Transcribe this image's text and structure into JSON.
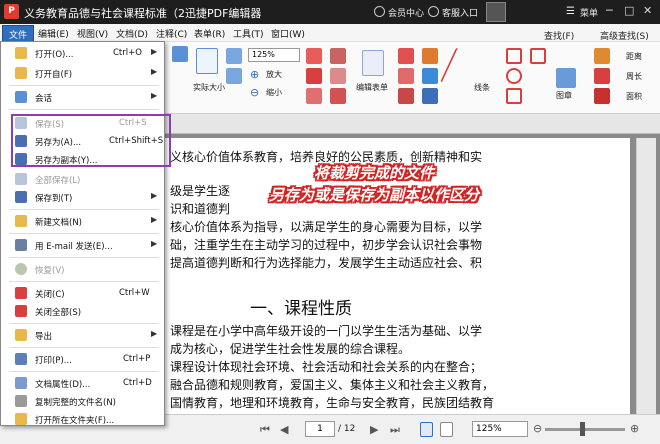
{
  "window": {
    "app_logo": "P",
    "title": "义务教育品德与社会课程标准（2迅捷PDF编辑器",
    "member_center": "会员中心",
    "client_login": "客服入口",
    "menu": "菜单",
    "win_controls": [
      "─",
      "□",
      "✕"
    ]
  },
  "menubar": [
    "文件",
    "编辑(E)",
    "视图(V)",
    "文档(D)",
    "注释(C)",
    "表单(R)",
    "工具(T)",
    "窗口(W)"
  ],
  "ribbon": {
    "zoom": "125%",
    "zoom_in": "放大",
    "zoom_out": "缩小",
    "actual_size": "实际大小",
    "edit_content": "编辑表单",
    "lines": "线条",
    "shapes": "图章",
    "find": "查找(F)",
    "advanced_find": "高级查找(S)",
    "distance": "距离",
    "perimeter": "周长",
    "area": "面积"
  },
  "file_menu": [
    {
      "label": "打开(O)...",
      "shortcut": "Ctrl+O",
      "arrow": true,
      "enabled": true,
      "icon": "open-folder-icon"
    },
    {
      "label": "打开自(F)",
      "shortcut": "",
      "arrow": true,
      "enabled": true,
      "icon": "open-from-icon"
    },
    {
      "label": "会话",
      "shortcut": "",
      "arrow": true,
      "enabled": true,
      "icon": "session-icon"
    },
    {
      "label": "保存(S)",
      "shortcut": "Ctrl+S",
      "arrow": false,
      "enabled": false,
      "icon": "save-icon"
    },
    {
      "label": "另存为(A)...",
      "shortcut": "Ctrl+Shift+S",
      "arrow": false,
      "enabled": true,
      "icon": "save-as-icon"
    },
    {
      "label": "另存为副本(Y)...",
      "shortcut": "",
      "arrow": false,
      "enabled": true,
      "icon": "save-copy-icon"
    },
    {
      "label": "全部保存(L)",
      "shortcut": "",
      "arrow": false,
      "enabled": false,
      "icon": "save-all-icon"
    },
    {
      "label": "保存到(T)",
      "shortcut": "",
      "arrow": true,
      "enabled": true,
      "icon": "save-to-icon"
    },
    {
      "label": "新建文档(N)",
      "shortcut": "",
      "arrow": true,
      "enabled": true,
      "icon": "new-document-icon"
    },
    {
      "label": "用 E-mail 发送(E)...",
      "shortcut": "",
      "arrow": true,
      "enabled": true,
      "icon": "email-icon"
    },
    {
      "label": "恢复(V)",
      "shortcut": "",
      "arrow": false,
      "enabled": false,
      "icon": "revert-icon"
    },
    {
      "label": "关闭(C)",
      "shortcut": "Ctrl+W",
      "arrow": false,
      "enabled": true,
      "icon": "close-doc-icon"
    },
    {
      "label": "关闭全部(S)",
      "shortcut": "",
      "arrow": false,
      "enabled": true,
      "icon": "close-all-icon"
    },
    {
      "label": "导出",
      "shortcut": "",
      "arrow": true,
      "enabled": true,
      "icon": "export-icon"
    },
    {
      "label": "打印(P)...",
      "shortcut": "Ctrl+P",
      "arrow": false,
      "enabled": true,
      "icon": "print-icon"
    },
    {
      "label": "文档属性(D)...",
      "shortcut": "Ctrl+D",
      "arrow": false,
      "enabled": true,
      "icon": "properties-icon"
    },
    {
      "label": "复制完整的文件名(N)",
      "shortcut": "",
      "arrow": false,
      "enabled": true,
      "icon": "copy-filename-icon"
    },
    {
      "label": "打开所在文件夹(F)...",
      "shortcut": "",
      "arrow": false,
      "enabled": true,
      "icon": "open-folder-location-icon"
    }
  ],
  "document": {
    "lines": [
      "义核心价值体系教育，培养良好的公民素质，创新精神和实",
      "级是学生逐",
      "识和道德判",
      "核心价值体系为指导，以满足学生的身心需要为目标，以学",
      "础，注重学生在主动学习的过程中，初步学会认识社会事物",
      "提高道德判断和行为选择能力，发展学生主动适应社会、积",
      "课程是在小学中高年级开设的一门以学生生活为基础、以学",
      "成为核心，促进学生社会性发展的综合课程。",
      "课程设计体现社会环境、社会活动和社会关系的内在整合；",
      "融合品德和规则教育，爱国主义、集体主义和社会主义教育，",
      "国情教育，地理和环境教育，生命与安全教育，民族团结教育"
    ],
    "heading": "一、课程性质"
  },
  "callout": {
    "line1": "将裁剪完成的文件",
    "line2": "另存为或是保存为副本以作区分"
  },
  "status": {
    "page_current": "1",
    "page_total": "/ 12",
    "zoom": "125%"
  }
}
